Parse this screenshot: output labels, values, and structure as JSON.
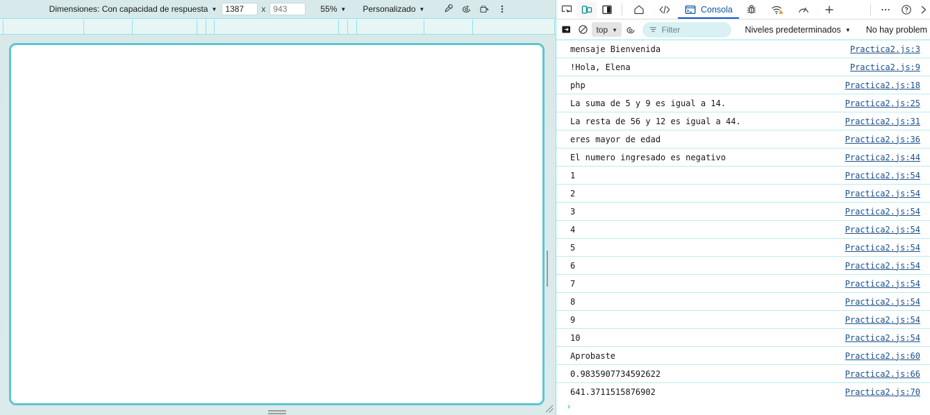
{
  "device_toolbar": {
    "dimensions_label": "Dimensiones: Con capacidad de respuesta",
    "dimensions_caret": "▼",
    "width_value": "1387",
    "x_separator": "x",
    "height_placeholder": "943",
    "height_value": "",
    "zoom_label": "55%",
    "zoom_caret": "▼",
    "throttling_label": "Personalizado",
    "throttling_caret": "▼",
    "icons": {
      "eyedropper": "eyedropper-icon",
      "rotate": "rotate-icon",
      "screenshot": "screenshot-icon",
      "more": "more-vertical-icon"
    }
  },
  "ruler": {
    "ticks": [
      4,
      120,
      190,
      283,
      296,
      308,
      487,
      500,
      513,
      610,
      680,
      798
    ]
  },
  "viewport": {
    "frame_color": "#5cc6cf",
    "page_background": "#ffffff",
    "handles": [
      "resize-handle-right",
      "resize-handle-bottom",
      "resize-handle-corner"
    ]
  },
  "devtools": {
    "left_buttons": [
      {
        "name": "inspect-element-icon",
        "active": false
      },
      {
        "name": "toggle-device-toolbar-icon",
        "active": true
      },
      {
        "name": "panel-layout-icon",
        "active": false
      }
    ],
    "tabs": [
      {
        "label": "",
        "icon": "home-icon",
        "active": false,
        "name": "tab-home"
      },
      {
        "label": "",
        "icon": "code-icon",
        "active": false,
        "name": "tab-elements"
      },
      {
        "label": "Consola",
        "icon": "console-icon",
        "active": true,
        "name": "tab-console"
      },
      {
        "label": "",
        "icon": "bug-icon",
        "active": false,
        "name": "tab-debugger"
      },
      {
        "label": "",
        "icon": "network-icon",
        "active": false,
        "name": "tab-network",
        "badge": "warning"
      },
      {
        "label": "",
        "icon": "performance-icon",
        "active": false,
        "name": "tab-performance"
      },
      {
        "label": "",
        "icon": "plus-icon",
        "active": false,
        "name": "tab-add"
      }
    ],
    "right_buttons": [
      {
        "name": "more-tools-icon",
        "glyph": "•••"
      },
      {
        "name": "help-icon",
        "glyph": "?"
      },
      {
        "name": "close-devtools-icon",
        "glyph": "›"
      }
    ]
  },
  "console_toolbar": {
    "split_console_icon": "split-console-icon",
    "clear_console_icon": "clear-console-icon",
    "context_value": "top",
    "context_caret": "▼",
    "eye_icon": "eye-icon",
    "filter_icon": "filter-icon",
    "filter_placeholder": "Filter",
    "filter_value": "",
    "levels_label": "Niveles predeterminados",
    "levels_caret": "▼",
    "issues_label": "No hay problem"
  },
  "console_messages": [
    {
      "text": "mensaje Bienvenida",
      "source": "Practica2.js:3"
    },
    {
      "text": "!Hola, Elena",
      "source": "Practica2.js:9"
    },
    {
      "text": "php",
      "source": "Practica2.js:18"
    },
    {
      "text": "La suma de 5 y 9 es igual a 14.",
      "source": "Practica2.js:25"
    },
    {
      "text": "La resta de 56 y 12 es igual a 44.",
      "source": "Practica2.js:31"
    },
    {
      "text": "eres mayor de edad",
      "source": "Practica2.js:36"
    },
    {
      "text": "El numero ingresado es negativo",
      "source": "Practica2.js:44"
    },
    {
      "text": "1",
      "source": "Practica2.js:54"
    },
    {
      "text": "2",
      "source": "Practica2.js:54"
    },
    {
      "text": "3",
      "source": "Practica2.js:54"
    },
    {
      "text": "4",
      "source": "Practica2.js:54"
    },
    {
      "text": "5",
      "source": "Practica2.js:54"
    },
    {
      "text": "6",
      "source": "Practica2.js:54"
    },
    {
      "text": "7",
      "source": "Practica2.js:54"
    },
    {
      "text": "8",
      "source": "Practica2.js:54"
    },
    {
      "text": "9",
      "source": "Practica2.js:54"
    },
    {
      "text": "10",
      "source": "Practica2.js:54"
    },
    {
      "text": "Aprobaste",
      "source": "Practica2.js:60"
    },
    {
      "text": "0.9835907734592622",
      "source": "Practica2.js:66"
    },
    {
      "text": "641.3711515876902",
      "source": "Practica2.js:70"
    }
  ],
  "console_prompt": {
    "glyph": "›"
  },
  "colors": {
    "accent_teal": "#5cc6cf",
    "devtools_active_tab": "#0b57d0",
    "link": "#1a4f8b",
    "row_separator": "#b8ecef",
    "device_bg": "#d7e9ea",
    "ruler_bg": "#e7f5f5"
  }
}
